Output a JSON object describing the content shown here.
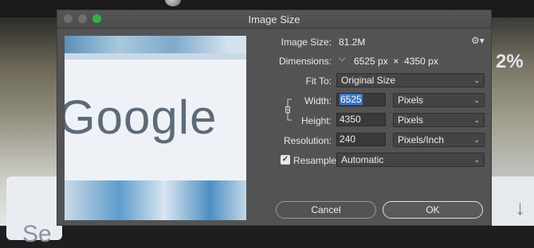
{
  "dialog": {
    "title": "Image Size"
  },
  "preview": {
    "text": "Google"
  },
  "background": {
    "left_text": "Se",
    "right_text": "2%",
    "right_arrow": "↓"
  },
  "image_size": {
    "label": "Image Size:",
    "value": "81.2M"
  },
  "dimensions": {
    "label": "Dimensions:",
    "width": "6525",
    "width_unit": "px",
    "times": "×",
    "height": "4350",
    "height_unit": "px"
  },
  "fit_to": {
    "label": "Fit To:",
    "value": "Original Size"
  },
  "width": {
    "label": "Width:",
    "value": "6525",
    "unit": "Pixels"
  },
  "height": {
    "label": "Height:",
    "value": "4350",
    "unit": "Pixels"
  },
  "resolution": {
    "label": "Resolution:",
    "value": "240",
    "unit": "Pixels/Inch"
  },
  "resample": {
    "label": "Resample:",
    "checked": true,
    "check_glyph": "✓",
    "value": "Automatic"
  },
  "buttons": {
    "cancel": "Cancel",
    "ok": "OK"
  },
  "colors": {
    "dialog_bg": "#535353",
    "accent": "#3d76c7",
    "maximize": "#2fb34a"
  }
}
